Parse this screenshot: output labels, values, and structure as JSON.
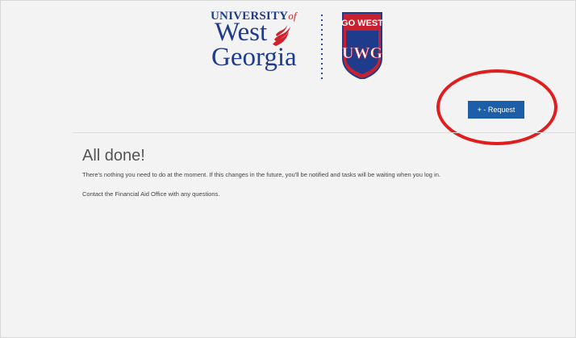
{
  "header": {
    "logo": {
      "university": "UNIVERSITY",
      "of": "of",
      "west": "West",
      "georgia": "Georgia"
    },
    "badge": {
      "top_text": "GO WEST",
      "monogram": "UWG",
      "colors": {
        "red": "#c8202f",
        "navy": "#1f3c8c"
      }
    }
  },
  "toolbar": {
    "request_label": "+ - Request"
  },
  "main": {
    "title": "All done!",
    "message": "There's nothing you need to do at the moment. If this changes in the future, you'll be notified and tasks will be waiting when you log in.",
    "contact": "Contact the Financial Aid Office with any questions."
  },
  "annotation": {
    "color": "#e01e1e"
  }
}
